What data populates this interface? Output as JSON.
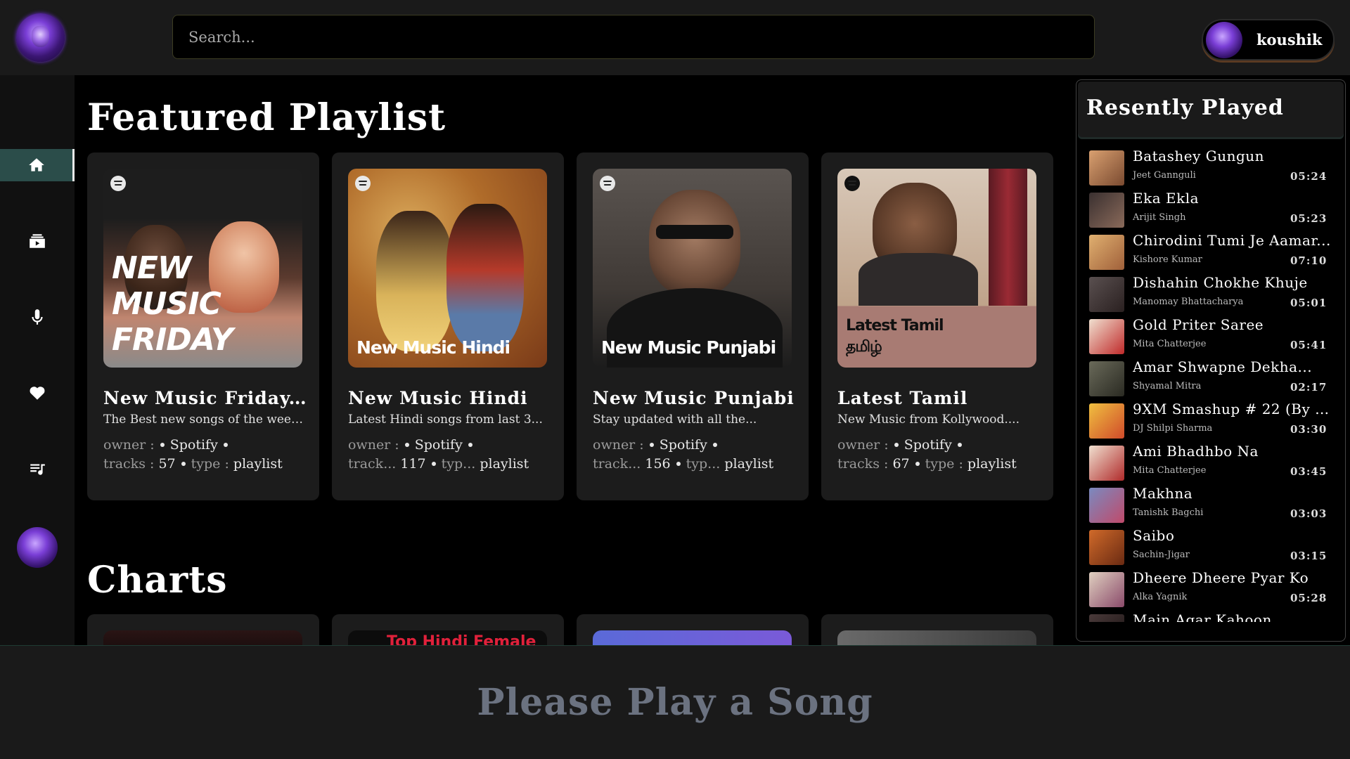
{
  "header": {
    "search_placeholder": "Search...",
    "user_name": "koushik"
  },
  "sidebar": {
    "items": [
      {
        "icon": "home-icon",
        "active": true
      },
      {
        "icon": "video-stack-icon",
        "active": false
      },
      {
        "icon": "microphone-icon",
        "active": false
      },
      {
        "icon": "heart-icon",
        "active": false
      },
      {
        "icon": "playlist-icon",
        "active": false
      }
    ]
  },
  "featured": {
    "title": "Featured Playlist",
    "cards": [
      {
        "cover_text": "NEW MUSIC FRIDAY",
        "title": "New Music Friday...",
        "desc": "The Best new songs of the week...",
        "owner_label": "owner :",
        "owner": "Spotify",
        "tracks_label": "tracks :",
        "tracks": "57",
        "type_label": "type :",
        "type": "playlist"
      },
      {
        "cover_text": "New Music Hindi",
        "title": "New Music Hindi",
        "desc": "Latest Hindi songs from last 3...",
        "owner_label": "owner :",
        "owner": "Spotify",
        "tracks_label": "track...",
        "tracks": "117",
        "type_label": "typ...",
        "type": "playlist"
      },
      {
        "cover_text": "New Music Punjabi",
        "title": "New Music Punjabi",
        "desc": "Stay updated with all the...",
        "owner_label": "owner :",
        "owner": "Spotify",
        "tracks_label": "track...",
        "tracks": "156",
        "type_label": "typ...",
        "type": "playlist"
      },
      {
        "cover_text": "Latest Tamil தமிழ்",
        "title": "Latest Tamil",
        "desc": "New Music from Kollywood....",
        "owner_label": "owner :",
        "owner": "Spotify",
        "tracks_label": "tracks :",
        "tracks": "67",
        "type_label": "type :",
        "type": "playlist"
      }
    ]
  },
  "charts": {
    "title": "Charts",
    "partial_label": "Top Hindi Female"
  },
  "recent": {
    "title": "Resently Played",
    "songs": [
      {
        "title": "Batashey Gungun",
        "artist": "Jeet Gannguli",
        "duration": "05:24"
      },
      {
        "title": "Eka Ekla",
        "artist": "Arijit Singh",
        "duration": "05:23"
      },
      {
        "title": "Chirodini Tumi Je Aamar...",
        "artist": "Kishore Kumar",
        "duration": "07:10"
      },
      {
        "title": "Dishahin Chokhe Khuje",
        "artist": "Manomay Bhattacharya",
        "duration": "05:01"
      },
      {
        "title": "Gold Priter Saree",
        "artist": "Mita Chatterjee",
        "duration": "05:41"
      },
      {
        "title": "Amar Shwapne Dekha...",
        "artist": "Shyamal Mitra",
        "duration": "02:17"
      },
      {
        "title": "9XM Smashup # 22 (By DJ...",
        "artist": "DJ Shilpi Sharma",
        "duration": "03:30"
      },
      {
        "title": "Ami Bhadhbo Na",
        "artist": "Mita Chatterjee",
        "duration": "03:45"
      },
      {
        "title": "Makhna",
        "artist": "Tanishk Bagchi",
        "duration": "03:03"
      },
      {
        "title": "Saibo",
        "artist": "Sachin-Jigar",
        "duration": "03:15"
      },
      {
        "title": "Dheere Dheere Pyar Ko",
        "artist": "Alka Yagnik",
        "duration": "05:28"
      },
      {
        "title": "Main Agar Kahoon",
        "artist": "",
        "duration": ""
      }
    ]
  },
  "player": {
    "message": "Please Play a Song"
  },
  "colors": {
    "accent": "#2b4d4a",
    "muted_text": "#6b7280",
    "panel": "#1c1c1c"
  }
}
